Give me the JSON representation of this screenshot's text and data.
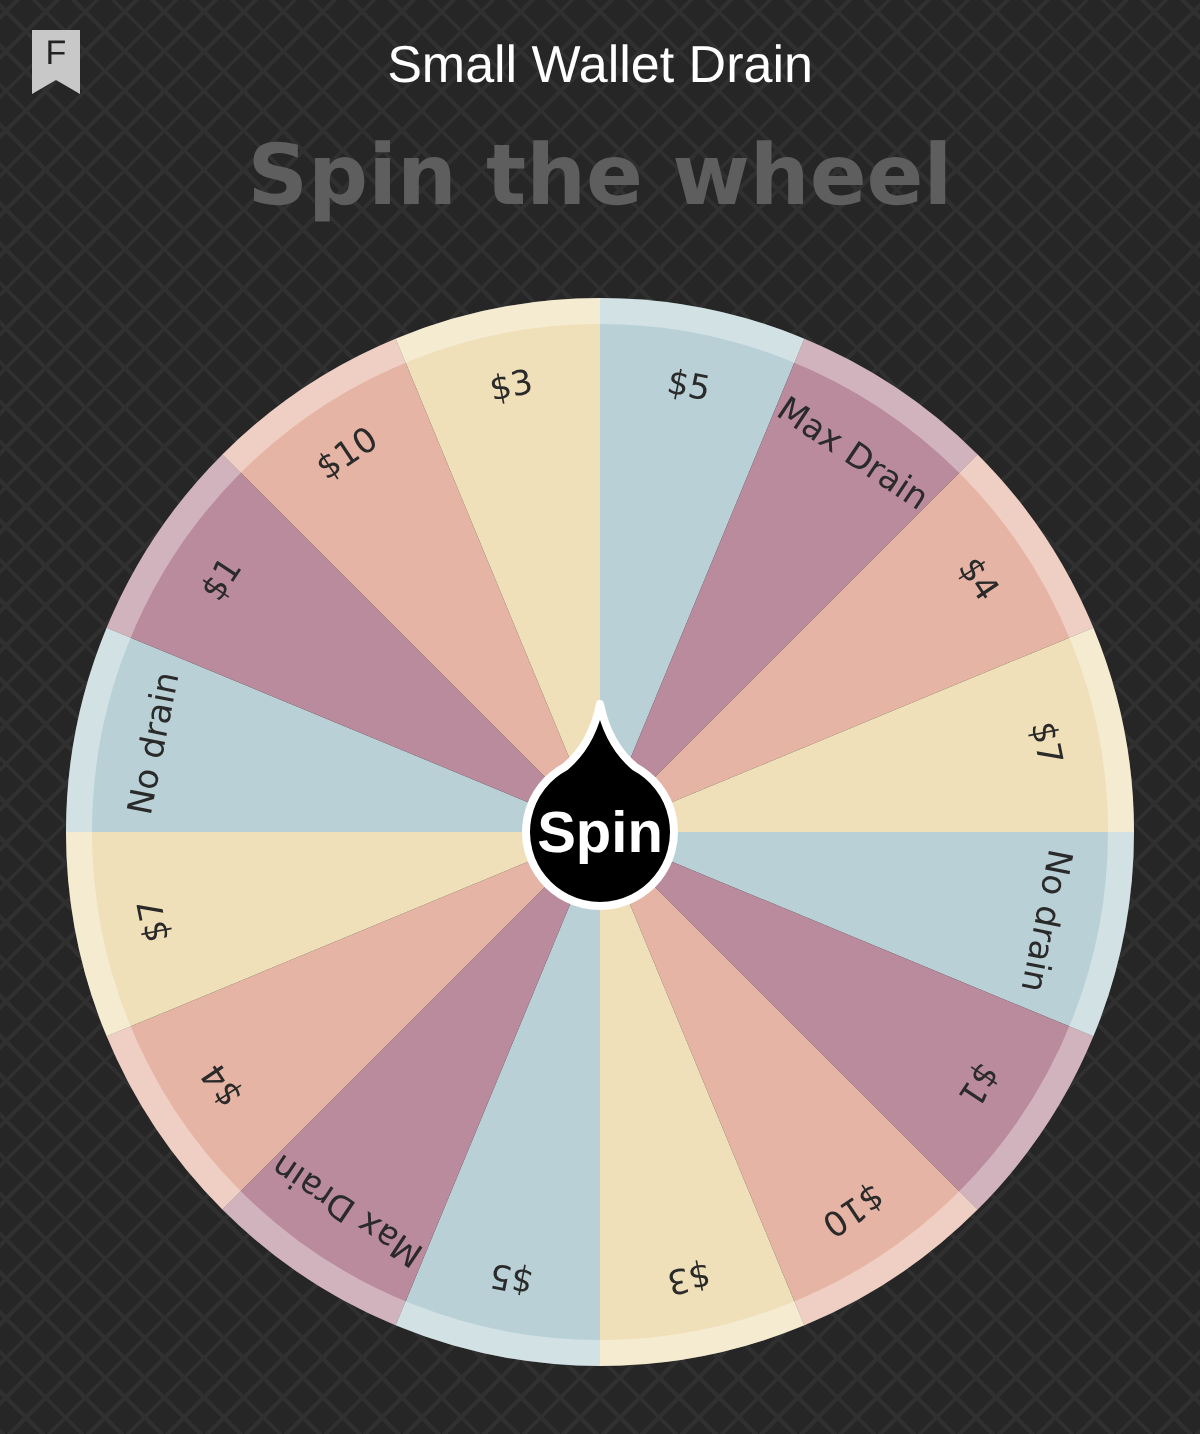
{
  "header": {
    "badge": "F",
    "title": "Small Wallet Drain"
  },
  "heading": "Spin the wheel",
  "wheel": {
    "button": "Spin",
    "segments": [
      {
        "label": "$5",
        "color": "#b9d1d6"
      },
      {
        "label": "Max Drain",
        "color": "#b98b9c"
      },
      {
        "label": "$4",
        "color": "#e6b4a4"
      },
      {
        "label": "$7",
        "color": "#f0e0b9"
      },
      {
        "label": "No drain",
        "color": "#b9d1d6"
      },
      {
        "label": "$1",
        "color": "#b98b9c"
      },
      {
        "label": "$10",
        "color": "#e6b4a4"
      },
      {
        "label": "$3",
        "color": "#f0e0b9"
      },
      {
        "label": "$5",
        "color": "#b9d1d6"
      },
      {
        "label": "Max Drain",
        "color": "#b98b9c"
      },
      {
        "label": "$4",
        "color": "#e6b4a4"
      },
      {
        "label": "$7",
        "color": "#f0e0b9"
      },
      {
        "label": "No drain",
        "color": "#b9d1d6"
      },
      {
        "label": "$1",
        "color": "#b98b9c"
      },
      {
        "label": "$10",
        "color": "#e6b4a4"
      },
      {
        "label": "$3",
        "color": "#f0e0b9"
      }
    ]
  }
}
